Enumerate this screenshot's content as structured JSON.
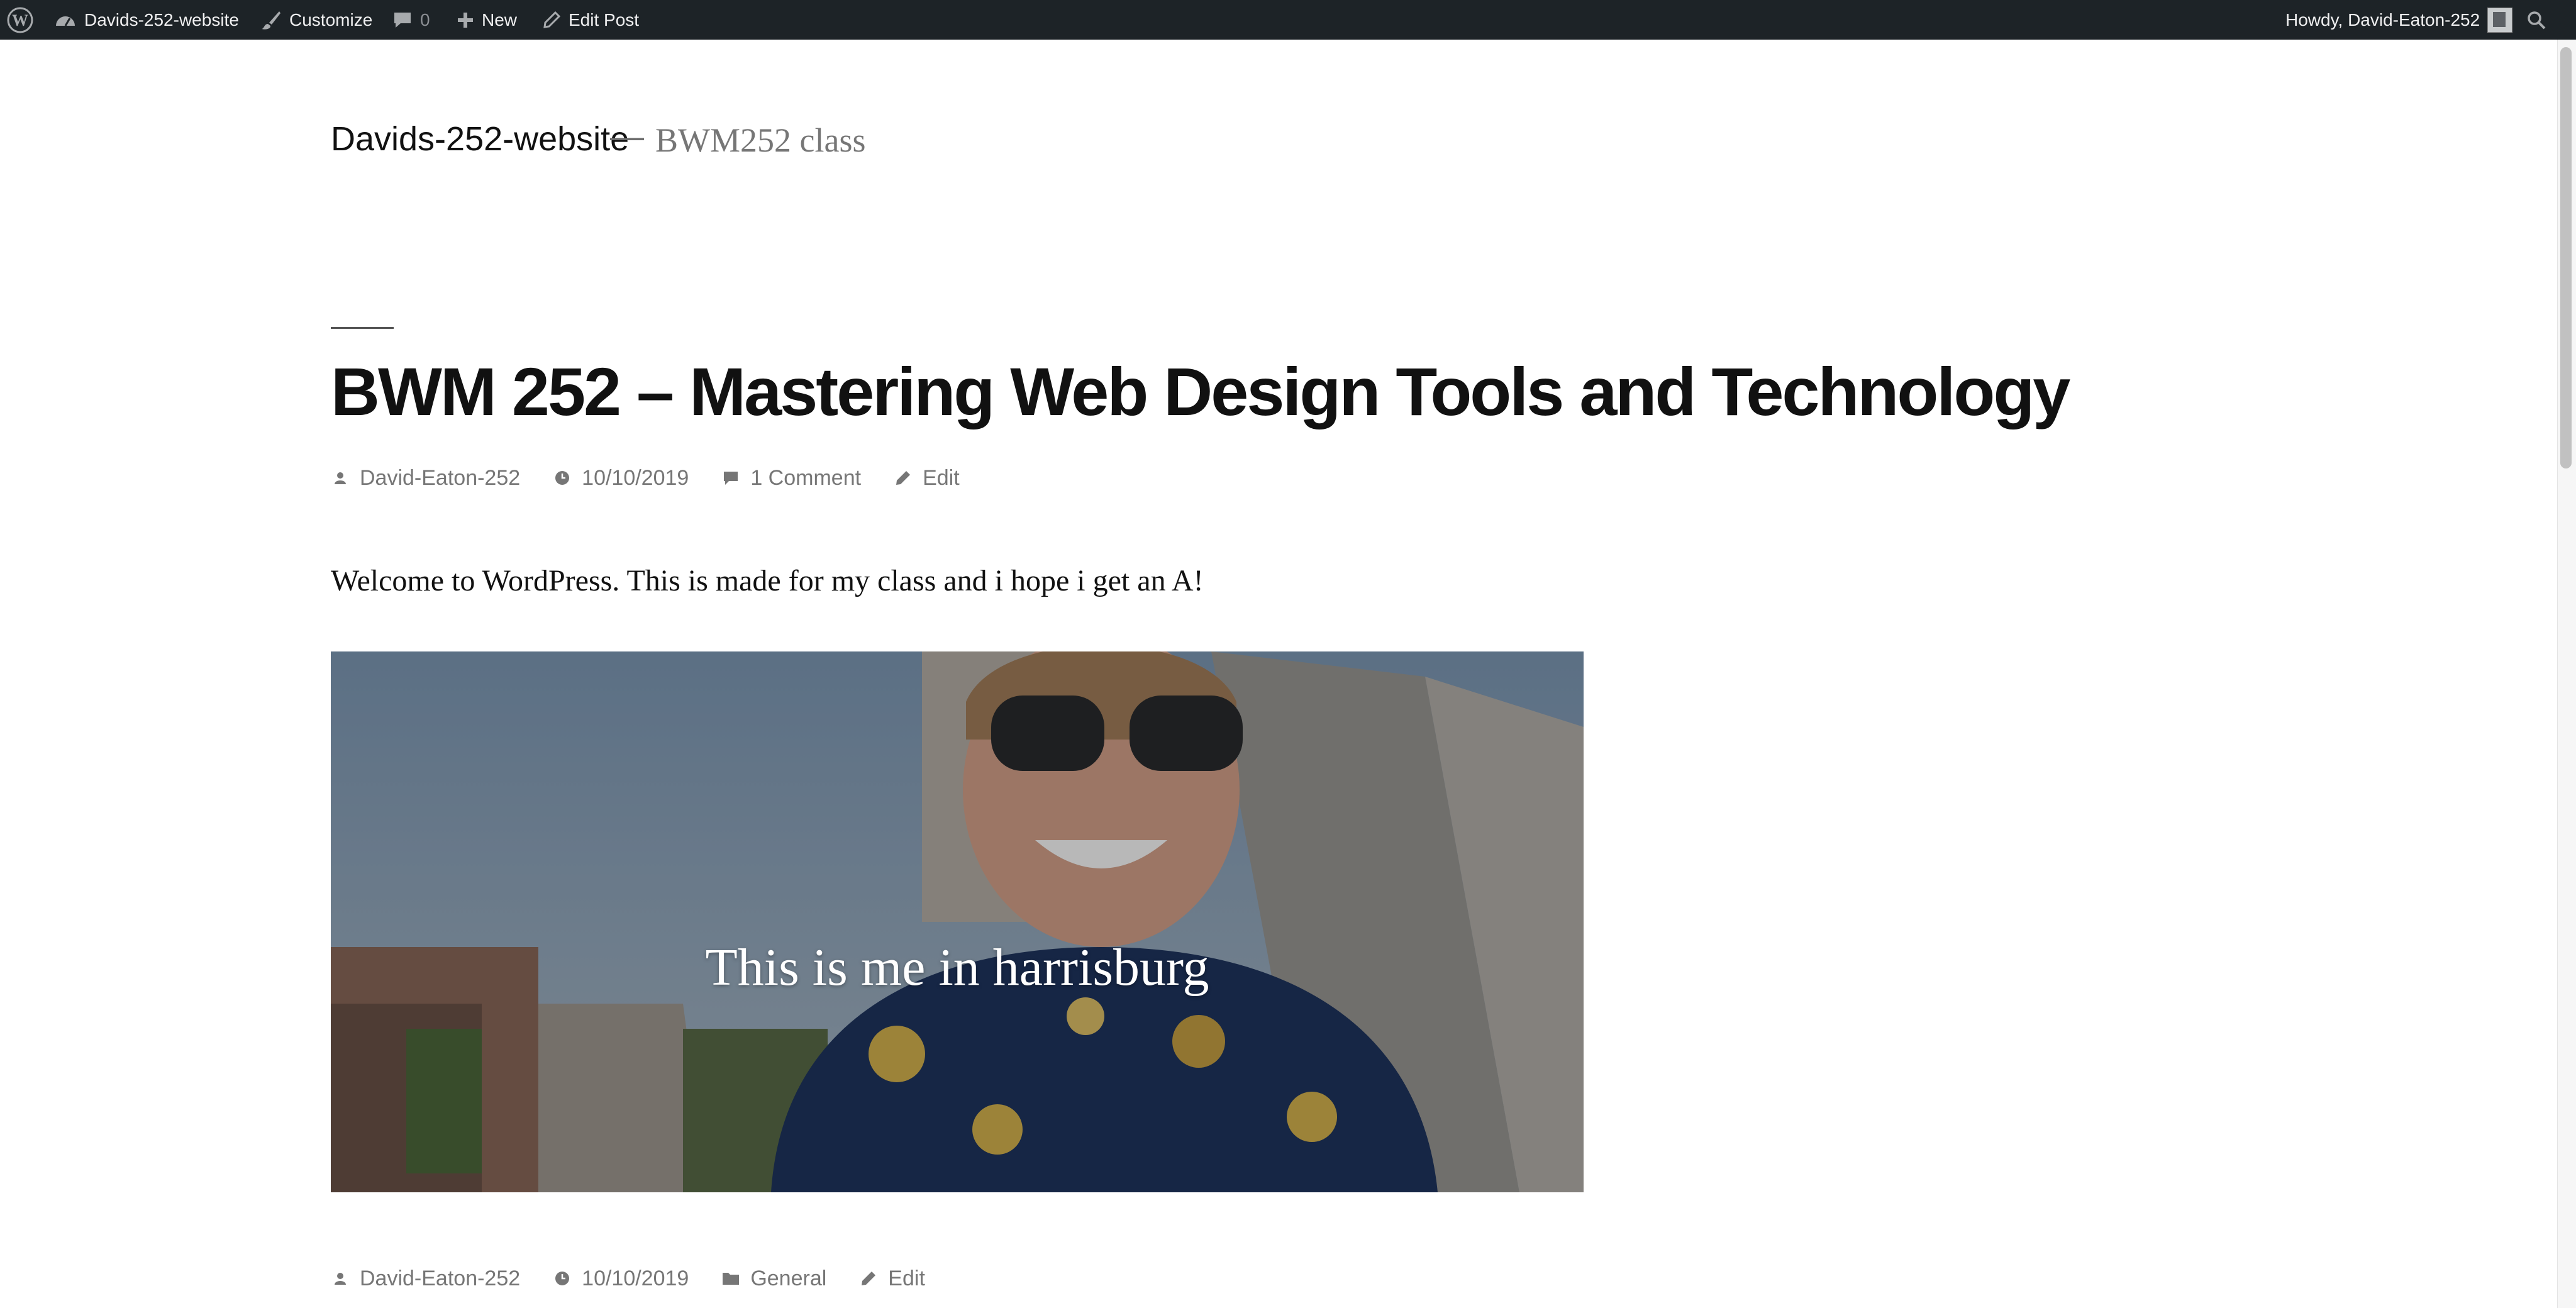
{
  "admin_bar": {
    "site_name": "Davids-252-website",
    "customize_label": "Customize",
    "comments_count": "0",
    "new_label": "New",
    "edit_post_label": "Edit Post",
    "howdy_label": "Howdy, David-Eaton-252",
    "icons": [
      "wordpress-logo-icon",
      "dashboard-icon",
      "paintbrush-icon",
      "comment-bubble-icon",
      "plus-icon",
      "pencil-icon",
      "search-icon"
    ]
  },
  "site": {
    "title": "Davids-252-website",
    "separator": "—",
    "description": "BWM252 class"
  },
  "post": {
    "title": "BWM 252 – Mastering Web Design Tools and Technology",
    "meta_top": {
      "author": "David-Eaton-252",
      "date": "10/10/2019",
      "comments": "1 Comment",
      "edit": "Edit"
    },
    "body": "Welcome to WordPress. This is made for my class and i hope i get an A!",
    "cover": {
      "caption": "This is me in harrisburg"
    },
    "meta_bottom": {
      "author": "David-Eaton-252",
      "date": "10/10/2019",
      "category": "General",
      "edit": "Edit"
    }
  },
  "colors": {
    "admin_bar_bg": "#1d2327",
    "text": "#111111",
    "meta_text": "#767676"
  }
}
